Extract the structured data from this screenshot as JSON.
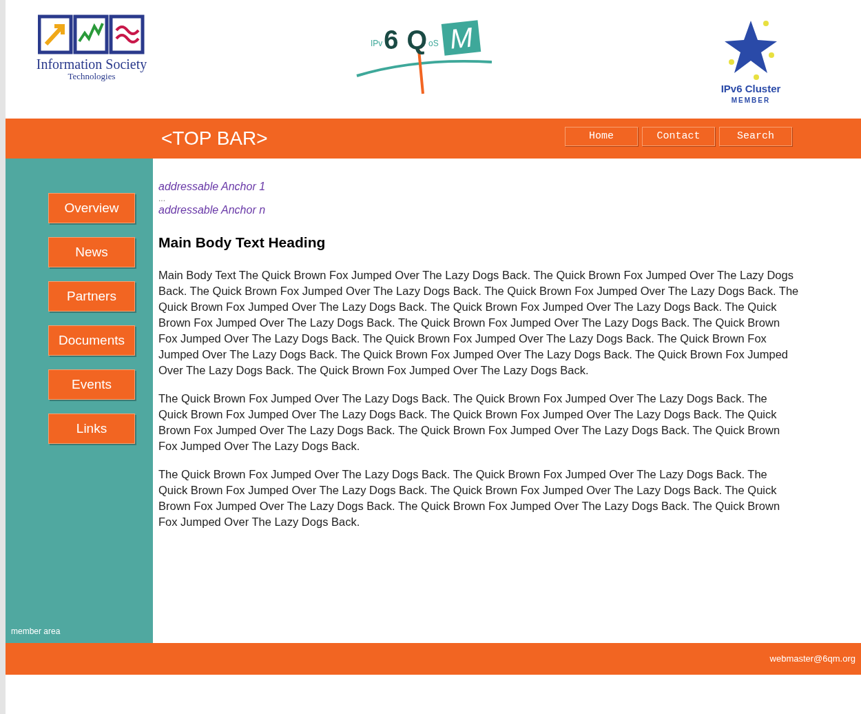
{
  "header": {
    "logos": [
      {
        "kind": "ist",
        "lines": [
          "Information Society",
          "Technologies"
        ]
      },
      {
        "kind": "sixqosm",
        "parts": [
          "IPv",
          "6",
          "Q",
          "oS",
          "M"
        ]
      },
      {
        "kind": "cluster",
        "lines": [
          "IPv6 Cluster",
          "MEMBER"
        ]
      }
    ]
  },
  "top_bar": {
    "title": "<TOP BAR>",
    "buttons": [
      "Home",
      "Contact",
      "Search"
    ]
  },
  "sidebar": {
    "items": [
      "Overview",
      "News",
      "Partners",
      "Documents",
      "Events",
      "Links"
    ],
    "footer_link": "member area"
  },
  "content": {
    "anchors": [
      "addressable Anchor 1",
      "...",
      "addressable Anchor n"
    ],
    "heading": "Main Body Text Heading",
    "paragraphs": [
      "Main Body Text The Quick Brown Fox Jumped Over The Lazy Dogs Back. The Quick Brown Fox Jumped Over The Lazy Dogs Back. The Quick Brown Fox Jumped Over The Lazy Dogs Back. The Quick Brown Fox Jumped Over The Lazy Dogs Back. The Quick Brown Fox Jumped Over The Lazy Dogs Back. The Quick Brown Fox Jumped Over The Lazy Dogs Back. The Quick Brown Fox Jumped Over The Lazy Dogs Back. The Quick Brown Fox Jumped Over The Lazy Dogs Back. The Quick Brown Fox Jumped Over The Lazy Dogs Back. The Quick Brown Fox Jumped Over The Lazy Dogs Back. The Quick Brown Fox Jumped Over The Lazy Dogs Back. The Quick Brown Fox Jumped Over The Lazy Dogs Back. The Quick Brown Fox Jumped Over The Lazy Dogs Back. The Quick Brown Fox Jumped Over The Lazy Dogs Back.",
      "The Quick Brown Fox Jumped Over The Lazy Dogs Back. The Quick Brown Fox Jumped Over The Lazy Dogs Back. The Quick Brown Fox Jumped Over The Lazy Dogs Back. The Quick Brown Fox Jumped Over The Lazy Dogs Back. The Quick Brown Fox Jumped Over The Lazy Dogs Back. The Quick Brown Fox Jumped Over The Lazy Dogs Back. The Quick Brown Fox Jumped Over The Lazy Dogs Back.",
      "The Quick Brown Fox Jumped Over The Lazy Dogs Back. The Quick Brown Fox Jumped Over The Lazy Dogs Back. The Quick Brown Fox Jumped Over The Lazy Dogs Back. The Quick Brown Fox Jumped Over The Lazy Dogs Back. The Quick Brown Fox Jumped Over The Lazy Dogs Back. The Quick Brown Fox Jumped Over The Lazy Dogs Back. The Quick Brown Fox Jumped Over The Lazy Dogs Back."
    ]
  },
  "footer": {
    "email": "webmaster@6qm.org"
  }
}
